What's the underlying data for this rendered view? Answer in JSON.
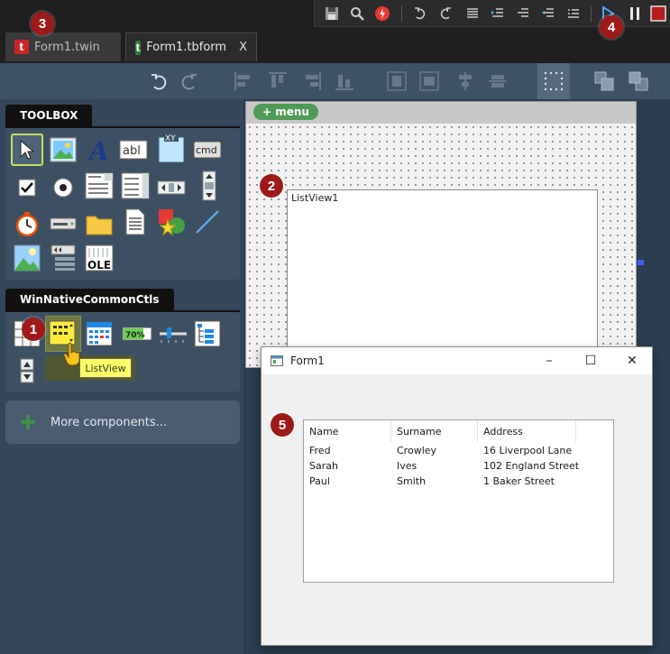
{
  "tabs": [
    {
      "label": "Form1.twin",
      "logo": "t"
    },
    {
      "label": "Form1.tbform",
      "logo": "t",
      "close": "X"
    }
  ],
  "run_toolbar": {
    "icons": [
      "save-icon",
      "search-icon",
      "no-entry-icon",
      "undo-icon",
      "redo-icon",
      "indent-icon",
      "outdent-icon",
      "block-comment-icon",
      "uncomment-icon",
      "list-icon",
      "run-icon",
      "pause-icon",
      "stop-icon"
    ],
    "colors": {
      "run": "#3c8dff",
      "stop": "#b71c1c",
      "no_entry": "#e53935"
    }
  },
  "design_toolbar": {
    "icons": [
      "undo-icon",
      "redo-icon",
      "align-left-icon",
      "align-top-icon",
      "align-right-icon",
      "align-bottom-icon",
      "center-horizontal-icon",
      "center-vertical-icon",
      "align-middle-icon",
      "align-center-icon",
      "grid-icon",
      "bring-to-front-icon",
      "send-to-back-icon"
    ]
  },
  "toolbox": {
    "header": "TOOLBOX",
    "tools": [
      "pointer",
      "picturebox",
      "label",
      "textbox",
      "frame",
      "commandbutton",
      "checkbox",
      "optionbutton",
      "combobox",
      "listbox",
      "hscrollbar",
      "vscrollbar",
      "timer",
      "drivelistbox",
      "dirlistbox",
      "filelistbox",
      "shape",
      "line",
      "image",
      "data",
      "ole"
    ],
    "frame_label": "XY",
    "textbox_label": "abl",
    "command_label": "cmd",
    "ole_label": "OLE"
  },
  "common_ctls": {
    "header": "WinNativeCommonCtls",
    "tools": [
      "imagelist",
      "listview",
      "monthview",
      "progressbar",
      "slider",
      "treeview",
      "updown"
    ],
    "progress_label": "70%"
  },
  "tooltip": "ListView",
  "more_components": "More components...",
  "designer": {
    "menu_button": "+ menu",
    "listview_caption": "ListView1"
  },
  "runtime_window": {
    "title": "Form1",
    "controls": {
      "minimize": "–",
      "maximize": "☐",
      "close": "✕"
    },
    "columns": [
      "Name",
      "Surname",
      "Address"
    ],
    "rows": [
      [
        "Fred",
        "Crowley",
        "16 Liverpool Lane"
      ],
      [
        "Sarah",
        "Ives",
        "102 England Street"
      ],
      [
        "Paul",
        "Smith",
        "1 Baker Street"
      ]
    ]
  },
  "badges": [
    "1",
    "2",
    "3",
    "4",
    "5"
  ]
}
